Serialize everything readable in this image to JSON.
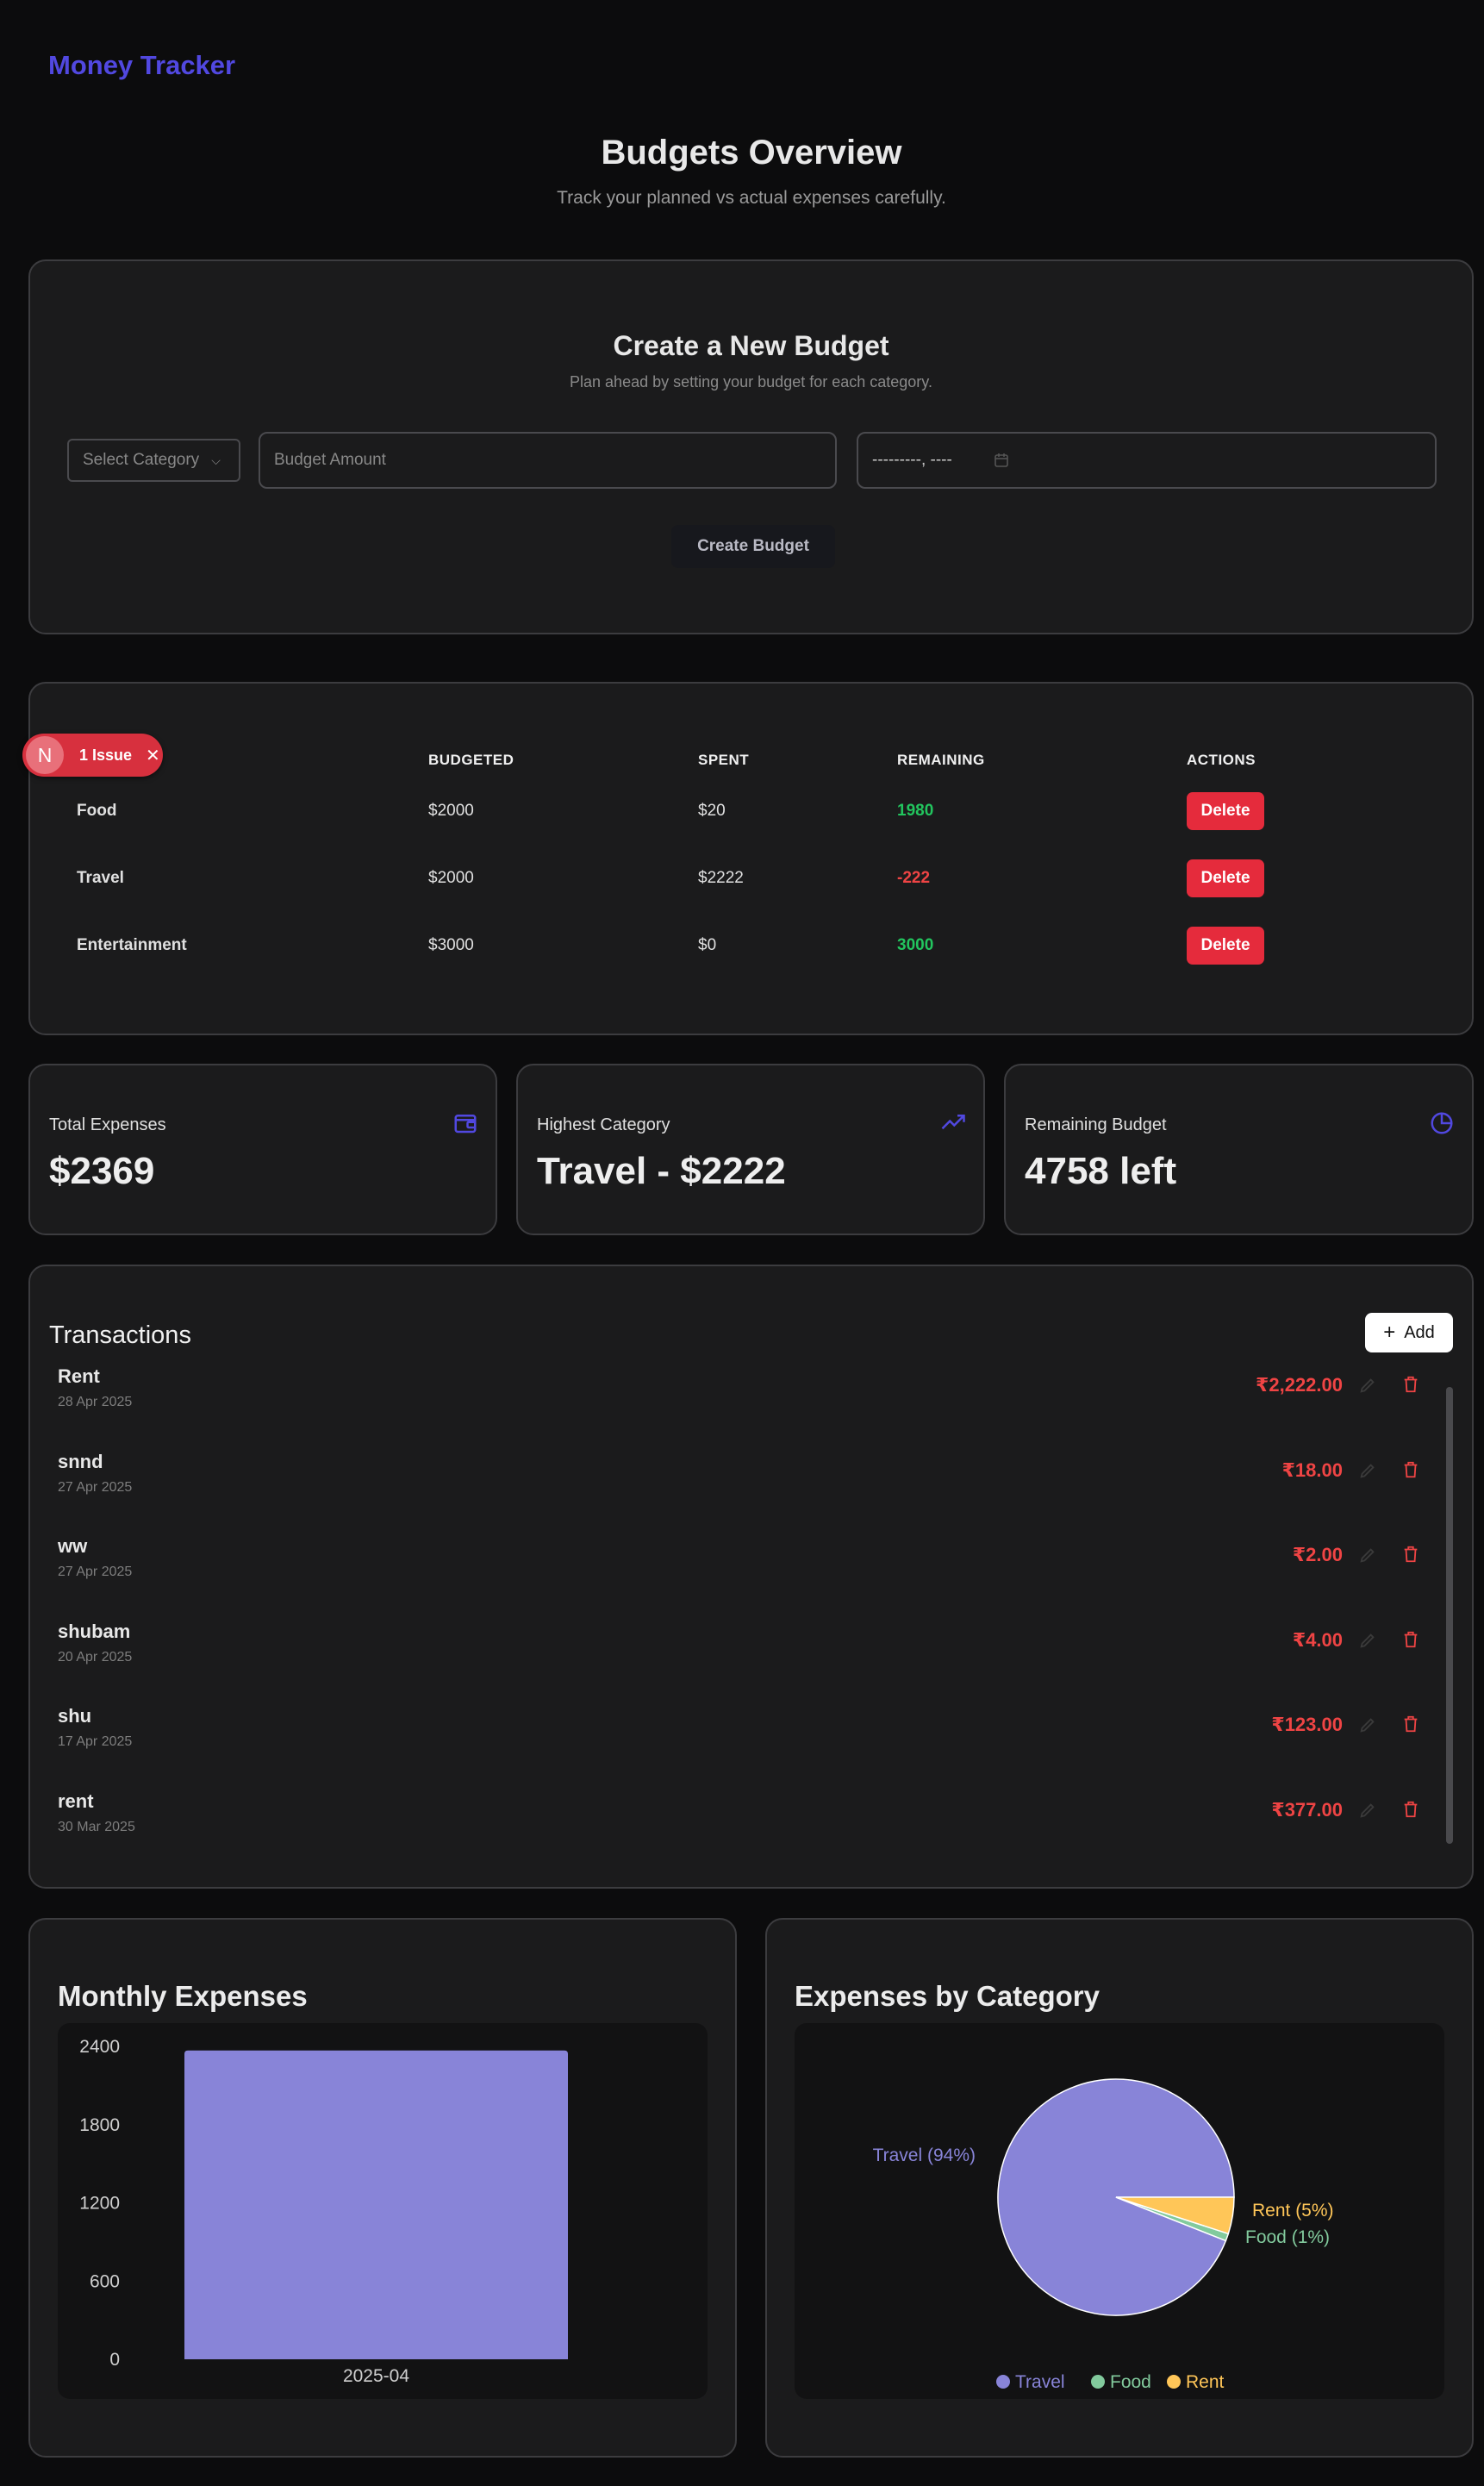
{
  "app": {
    "brand": "Money Tracker"
  },
  "header": {
    "title": "Budgets Overview",
    "subtitle": "Track your planned vs actual expenses carefully."
  },
  "create_budget": {
    "title": "Create a New Budget",
    "subtitle": "Plan ahead by setting your budget for each category.",
    "category_select": "Select Category",
    "amount_placeholder": "Budget Amount",
    "date_value": "---------, ----",
    "submit_label": "Create Budget"
  },
  "issue_badge": {
    "avatar_letter": "N",
    "label": "1 Issue",
    "close": "✕"
  },
  "budget_table": {
    "headers": [
      "BUDGETED",
      "SPENT",
      "REMAINING",
      "ACTIONS"
    ],
    "delete_label": "Delete",
    "rows": [
      {
        "category": "Food",
        "budgeted": "$2000",
        "spent": "$20",
        "remaining": "1980",
        "status": "positive"
      },
      {
        "category": "Travel",
        "budgeted": "$2000",
        "spent": "$2222",
        "remaining": "-222",
        "status": "negative"
      },
      {
        "category": "Entertainment",
        "budgeted": "$3000",
        "spent": "$0",
        "remaining": "3000",
        "status": "positive"
      }
    ]
  },
  "stats": [
    {
      "label": "Total Expenses",
      "value": "$2369",
      "icon": "wallet-icon"
    },
    {
      "label": "Highest Category",
      "value": "Travel - $2222",
      "icon": "trending-up-icon"
    },
    {
      "label": "Remaining Budget",
      "value": "4758 left",
      "icon": "pie-chart-icon"
    }
  ],
  "transactions": {
    "title": "Transactions",
    "add_label": "Add",
    "items": [
      {
        "name": "Rent",
        "date": "28 Apr 2025",
        "amount": "₹2,222.00"
      },
      {
        "name": "snnd",
        "date": "27 Apr 2025",
        "amount": "₹18.00"
      },
      {
        "name": "ww",
        "date": "27 Apr 2025",
        "amount": "₹2.00"
      },
      {
        "name": "shubam",
        "date": "20 Apr 2025",
        "amount": "₹4.00"
      },
      {
        "name": "shu",
        "date": "17 Apr 2025",
        "amount": "₹123.00"
      },
      {
        "name": "rent",
        "date": "30 Mar 2025",
        "amount": "₹377.00"
      }
    ]
  },
  "colors": {
    "accent": "#5148e0",
    "positive": "#22c55e",
    "negative": "#ef4444",
    "travel": "#8884d8",
    "food": "#82ca9d",
    "rent": "#ffc658"
  },
  "chart_data": [
    {
      "type": "bar",
      "title": "Monthly Expenses",
      "categories": [
        "2025-04"
      ],
      "values": [
        2369
      ],
      "ylim": [
        0,
        2400
      ],
      "yticks": [
        0,
        600,
        1200,
        1800,
        2400
      ],
      "color": "#8884d8"
    },
    {
      "type": "pie",
      "title": "Expenses by Category",
      "slices": [
        {
          "label": "Travel",
          "value": 94,
          "display": "Travel (94%)",
          "color": "#8884d8"
        },
        {
          "label": "Food",
          "value": 1,
          "display": "Food (1%)",
          "color": "#82ca9d"
        },
        {
          "label": "Rent",
          "value": 5,
          "display": "Rent (5%)",
          "color": "#ffc658"
        }
      ],
      "legend": [
        "Travel",
        "Food",
        "Rent"
      ],
      "legend_position": "bottom"
    }
  ]
}
